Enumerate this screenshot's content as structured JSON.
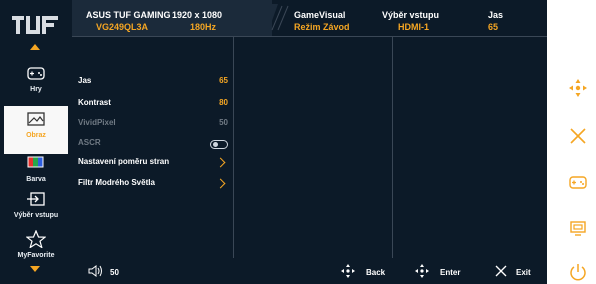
{
  "header": {
    "model_line1": "ASUS TUF GAMING",
    "model_line2": "VG249QL3A",
    "resolution": "1920 x 1080",
    "refresh": "180Hz",
    "gamevisual_label": "GameVisual",
    "gamevisual_value": "Režim Závod",
    "input_label": "Výběr vstupu",
    "input_value": "HDMI-1",
    "brightness_label": "Jas",
    "brightness_value": "65"
  },
  "sidebar": {
    "items": [
      {
        "label": "Hry",
        "icon": "gamepad-icon"
      },
      {
        "label": "Obraz",
        "icon": "image-icon"
      },
      {
        "label": "Barva",
        "icon": "color-icon"
      },
      {
        "label": "Výběr vstupu",
        "icon": "input-icon"
      },
      {
        "label": "MyFavorite",
        "icon": "star-icon"
      }
    ]
  },
  "menu": {
    "rows": [
      {
        "label": "Jas",
        "value": "65"
      },
      {
        "label": "Kontrast",
        "value": "80"
      },
      {
        "label": "VividPixel",
        "value": "50"
      },
      {
        "label": "ASCR",
        "value": ""
      },
      {
        "label": "Nastavení poměru stran",
        "value": ""
      },
      {
        "label": "Filtr Modrého Světla",
        "value": ""
      }
    ]
  },
  "footer": {
    "volume": "50",
    "back_label": "Back",
    "enter_label": "Enter",
    "exit_label": "Exit"
  },
  "colors": {
    "background": "#0c1a28",
    "accent": "#f5a623",
    "active_item": "#f8f8f8"
  }
}
